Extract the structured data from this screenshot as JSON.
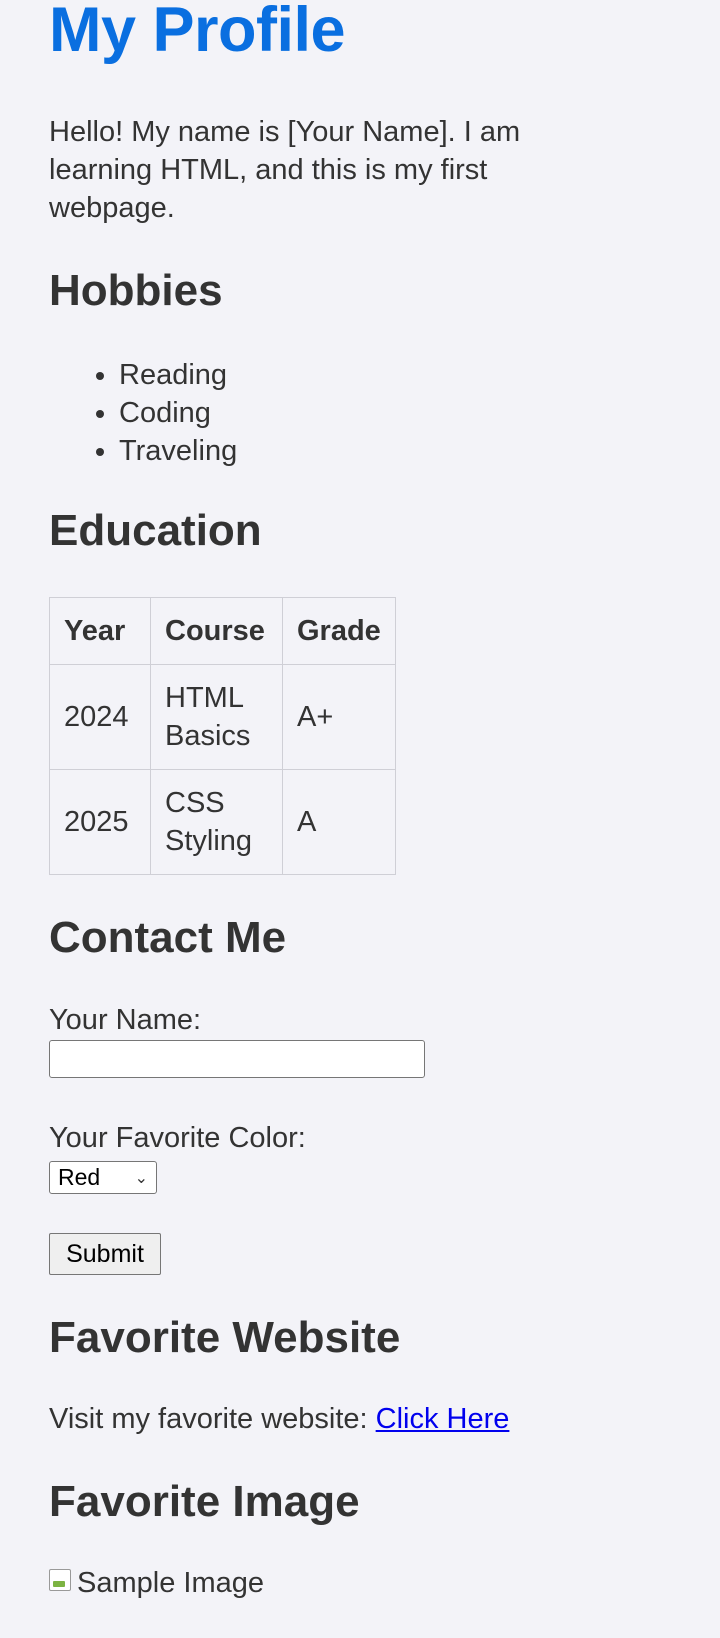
{
  "page": {
    "title": "My Profile",
    "intro": "Hello! My name is [Your Name]. I am learning HTML, and this is my first webpage."
  },
  "hobbies": {
    "heading": "Hobbies",
    "items": [
      "Reading",
      "Coding",
      "Traveling"
    ]
  },
  "education": {
    "heading": "Education",
    "columns": [
      "Year",
      "Course",
      "Grade"
    ],
    "rows": [
      {
        "year": "2024",
        "course": "HTML Basics",
        "grade": "A+"
      },
      {
        "year": "2025",
        "course": "CSS Styling",
        "grade": "A"
      }
    ]
  },
  "contact": {
    "heading": "Contact Me",
    "name_label": "Your Name:",
    "name_value": "",
    "color_label": "Your Favorite Color:",
    "color_selected": "Red",
    "submit_label": "Submit"
  },
  "website": {
    "heading": "Favorite Website",
    "text": "Visit my favorite website: ",
    "link_text": "Click Here"
  },
  "image": {
    "heading": "Favorite Image",
    "alt": "Sample Image",
    "icon": "broken-image-icon"
  },
  "colors": {
    "title": "#0a6fe0",
    "text": "#333333",
    "link": "#0000ee",
    "background": "#f3f3f8"
  }
}
